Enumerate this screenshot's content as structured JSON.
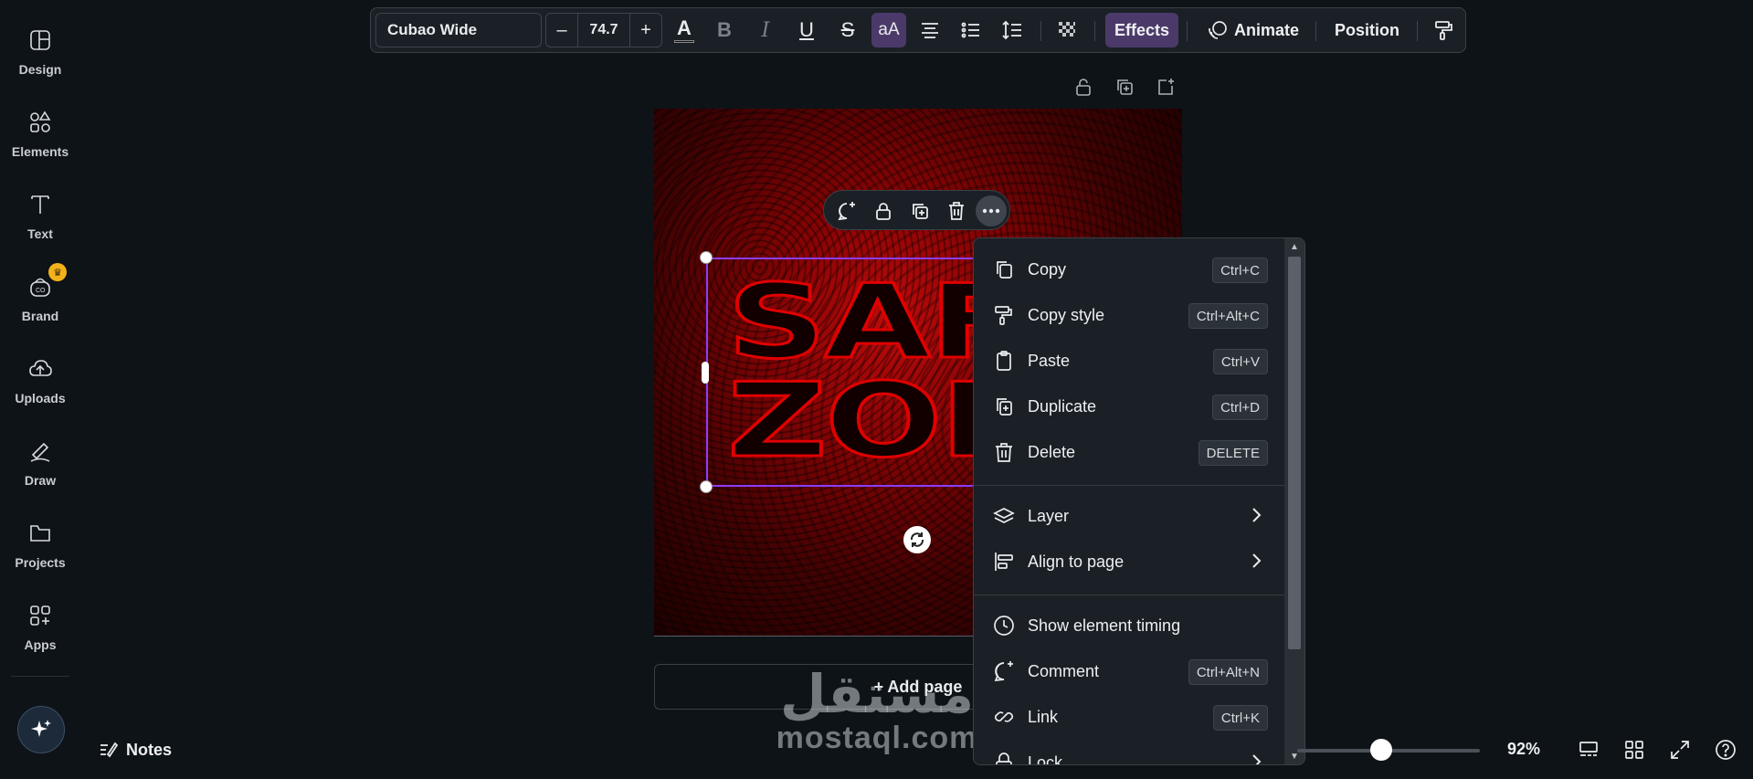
{
  "sidebar": {
    "items": [
      {
        "label": "Design",
        "icon": "design-icon"
      },
      {
        "label": "Elements",
        "icon": "elements-icon"
      },
      {
        "label": "Text",
        "icon": "text-icon"
      },
      {
        "label": "Brand",
        "icon": "brand-icon"
      },
      {
        "label": "Uploads",
        "icon": "uploads-icon"
      },
      {
        "label": "Draw",
        "icon": "draw-icon"
      },
      {
        "label": "Projects",
        "icon": "projects-icon"
      },
      {
        "label": "Apps",
        "icon": "apps-icon"
      }
    ],
    "crown_glyph": "♛"
  },
  "toolbar": {
    "font_name": "Cubao Wide",
    "size_minus": "–",
    "font_size": "74.7",
    "size_plus": "+",
    "text_color_glyph": "A",
    "bold_glyph": "B",
    "italic_glyph": "I",
    "underline_glyph": "U",
    "strike_glyph": "S",
    "case_glyph": "aA",
    "effects_label": "Effects",
    "animate_label": "Animate",
    "position_label": "Position"
  },
  "canvas": {
    "line1": "SAF",
    "line2": "ZOM",
    "add_page_label": "+ Add page",
    "accent_color": "#8b3dff"
  },
  "context_menu": {
    "items": [
      {
        "label": "Copy",
        "shortcut": "Ctrl+C",
        "icon": "copy-icon"
      },
      {
        "label": "Copy style",
        "shortcut": "Ctrl+Alt+C",
        "icon": "paint-roller-icon"
      },
      {
        "label": "Paste",
        "shortcut": "Ctrl+V",
        "icon": "clipboard-icon"
      },
      {
        "label": "Duplicate",
        "shortcut": "Ctrl+D",
        "icon": "duplicate-icon"
      },
      {
        "label": "Delete",
        "shortcut": "DELETE",
        "icon": "trash-icon"
      },
      {
        "label": "Layer",
        "icon": "layers-icon"
      },
      {
        "label": "Align to page",
        "icon": "align-icon"
      },
      {
        "label": "Show element timing",
        "icon": "clock-icon"
      },
      {
        "label": "Comment",
        "shortcut": "Ctrl+Alt+N",
        "icon": "comment-icon"
      },
      {
        "label": "Link",
        "shortcut": "Ctrl+K",
        "icon": "link-icon"
      },
      {
        "label": "Lock",
        "icon": "lock-icon"
      }
    ]
  },
  "bottom": {
    "notes_label": "Notes",
    "zoom": "92%",
    "zoom_fraction": 0.46
  },
  "watermark": {
    "arabic": "مستقل",
    "latin": "mostaql.com"
  }
}
